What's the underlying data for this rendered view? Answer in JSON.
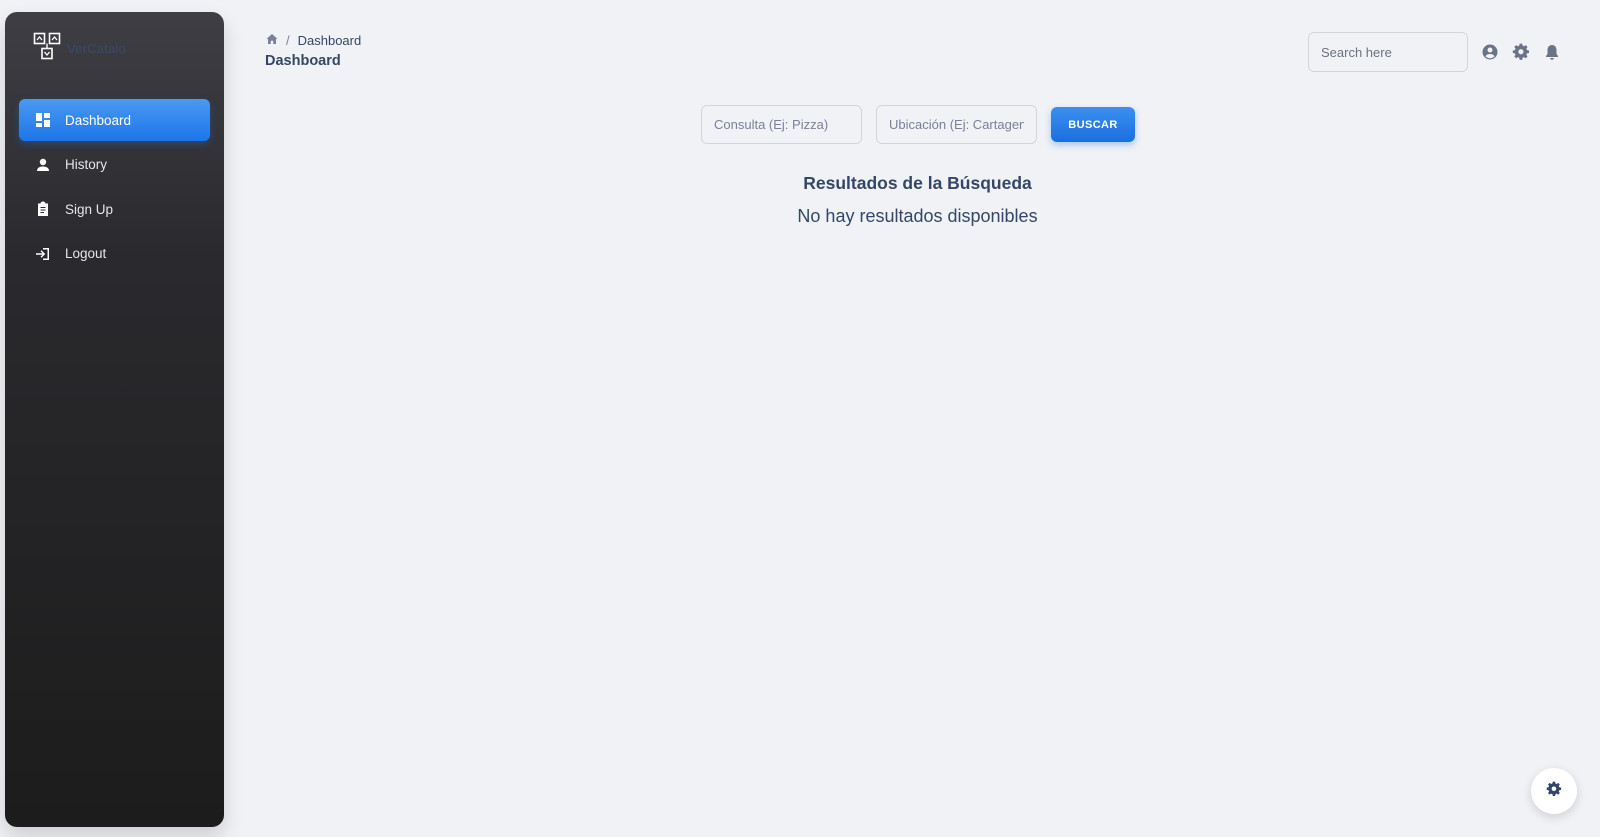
{
  "sidebar": {
    "brand": {
      "name": "VerCatalo",
      "logo_icon": "sitemap-logo-icon"
    },
    "items": [
      {
        "label": "Dashboard",
        "icon": "dashboard-icon",
        "active": true
      },
      {
        "label": "History",
        "icon": "person-icon",
        "active": false
      },
      {
        "label": "Sign Up",
        "icon": "clipboard-icon",
        "active": false
      },
      {
        "label": "Logout",
        "icon": "login-arrow-icon",
        "active": false
      }
    ]
  },
  "header": {
    "breadcrumb": {
      "home_icon": "home-icon",
      "separator": "/",
      "current": "Dashboard"
    },
    "title": "Dashboard",
    "search_placeholder": "Search here",
    "icons": [
      "account-circle-icon",
      "gear-icon",
      "bell-icon"
    ]
  },
  "search": {
    "query_placeholder": "Consulta (Ej: Pizza)",
    "location_placeholder": "Ubicación (Ej: Cartagen...",
    "button_label": "BUSCAR"
  },
  "results": {
    "title": "Resultados de la Búsqueda",
    "empty_message": "No hay resultados disponibles"
  },
  "floating": {
    "icon": "gear-icon"
  },
  "colors": {
    "accent": "#1a73e8",
    "sidebar_top": "#3e3e44",
    "sidebar_bottom": "#1c1c1c",
    "background": "#f0f2f5",
    "text": "#344767"
  }
}
